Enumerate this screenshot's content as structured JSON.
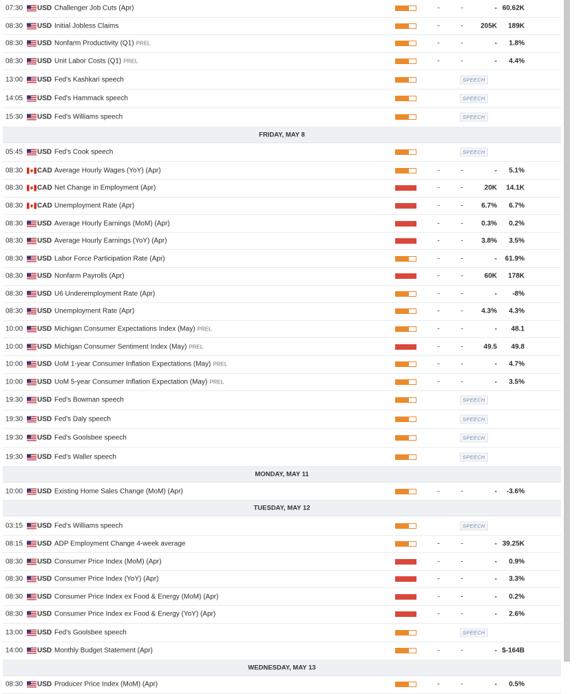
{
  "speech_label": "SPEECH",
  "prel_label": "PREL",
  "rows": [
    {
      "type": "event",
      "time": "07:30",
      "flag": "us",
      "currency": "USD",
      "name": "Challenger Job Cuts (Apr)",
      "prel": false,
      "impact": "medium",
      "actual": "-",
      "forecast": "-",
      "consensus": "-",
      "previous": "60.62K"
    },
    {
      "type": "event",
      "time": "08:30",
      "flag": "us",
      "currency": "USD",
      "name": "Initial Jobless Claims",
      "prel": false,
      "impact": "medium",
      "actual": "-",
      "forecast": "-",
      "consensus": "205K",
      "previous": "189K"
    },
    {
      "type": "event",
      "time": "08:30",
      "flag": "us",
      "currency": "USD",
      "name": "Nonfarm Productivity (Q1)",
      "prel": true,
      "impact": "medium",
      "actual": "-",
      "forecast": "-",
      "consensus": "-",
      "previous": "1.8%"
    },
    {
      "type": "event",
      "time": "08:30",
      "flag": "us",
      "currency": "USD",
      "name": "Unit Labor Costs (Q1)",
      "prel": true,
      "impact": "medium",
      "actual": "-",
      "forecast": "-",
      "consensus": "-",
      "previous": "4.4%"
    },
    {
      "type": "speech",
      "time": "13:00",
      "flag": "us",
      "currency": "USD",
      "name": "Fed's Kashkari speech",
      "impact": "medium"
    },
    {
      "type": "speech",
      "time": "14:05",
      "flag": "us",
      "currency": "USD",
      "name": "Fed's Hammack speech",
      "impact": "medium"
    },
    {
      "type": "speech",
      "time": "15:30",
      "flag": "us",
      "currency": "USD",
      "name": "Fed's Williams speech",
      "impact": "medium"
    },
    {
      "type": "day",
      "label": "FRIDAY, MAY 8"
    },
    {
      "type": "speech",
      "time": "05:45",
      "flag": "us",
      "currency": "USD",
      "name": "Fed's Cook speech",
      "impact": "medium"
    },
    {
      "type": "event",
      "time": "08:30",
      "flag": "ca",
      "currency": "CAD",
      "name": "Average Hourly Wages (YoY) (Apr)",
      "prel": false,
      "impact": "medium",
      "actual": "-",
      "forecast": "-",
      "consensus": "-",
      "previous": "5.1%"
    },
    {
      "type": "event",
      "time": "08:30",
      "flag": "ca",
      "currency": "CAD",
      "name": "Net Change in Employment (Apr)",
      "prel": false,
      "impact": "high",
      "actual": "-",
      "forecast": "-",
      "consensus": "20K",
      "previous": "14.1K"
    },
    {
      "type": "event",
      "time": "08:30",
      "flag": "ca",
      "currency": "CAD",
      "name": "Unemployment Rate (Apr)",
      "prel": false,
      "impact": "high",
      "actual": "-",
      "forecast": "-",
      "consensus": "6.7%",
      "previous": "6.7%"
    },
    {
      "type": "event",
      "time": "08:30",
      "flag": "us",
      "currency": "USD",
      "name": "Average Hourly Earnings (MoM) (Apr)",
      "prel": false,
      "impact": "high",
      "actual": "-",
      "forecast": "-",
      "consensus": "0.3%",
      "previous": "0.2%"
    },
    {
      "type": "event",
      "time": "08:30",
      "flag": "us",
      "currency": "USD",
      "name": "Average Hourly Earnings (YoY) (Apr)",
      "prel": false,
      "impact": "high",
      "actual": "-",
      "forecast": "-",
      "consensus": "3.8%",
      "previous": "3.5%"
    },
    {
      "type": "event",
      "time": "08:30",
      "flag": "us",
      "currency": "USD",
      "name": "Labor Force Participation Rate (Apr)",
      "prel": false,
      "impact": "medium",
      "actual": "-",
      "forecast": "-",
      "consensus": "-",
      "previous": "61.9%"
    },
    {
      "type": "event",
      "time": "08:30",
      "flag": "us",
      "currency": "USD",
      "name": "Nonfarm Payrolls (Apr)",
      "prel": false,
      "impact": "high",
      "actual": "-",
      "forecast": "-",
      "consensus": "60K",
      "previous": "178K"
    },
    {
      "type": "event",
      "time": "08:30",
      "flag": "us",
      "currency": "USD",
      "name": "U6 Underemployment Rate (Apr)",
      "prel": false,
      "impact": "medium",
      "actual": "-",
      "forecast": "-",
      "consensus": "-",
      "previous": "-8%"
    },
    {
      "type": "event",
      "time": "08:30",
      "flag": "us",
      "currency": "USD",
      "name": "Unemployment Rate (Apr)",
      "prel": false,
      "impact": "medium",
      "actual": "-",
      "forecast": "-",
      "consensus": "4.3%",
      "previous": "4.3%"
    },
    {
      "type": "event",
      "time": "10:00",
      "flag": "us",
      "currency": "USD",
      "name": "Michigan Consumer Expectations Index (May)",
      "prel": true,
      "impact": "medium",
      "actual": "-",
      "forecast": "-",
      "consensus": "-",
      "previous": "48.1"
    },
    {
      "type": "event",
      "time": "10:00",
      "flag": "us",
      "currency": "USD",
      "name": "Michigan Consumer Sentiment Index (May)",
      "prel": true,
      "impact": "high",
      "actual": "-",
      "forecast": "-",
      "consensus": "49.5",
      "previous": "49.8"
    },
    {
      "type": "event",
      "time": "10:00",
      "flag": "us",
      "currency": "USD",
      "name": "UoM 1-year Consumer Inflation Expectations (May)",
      "prel": true,
      "impact": "medium",
      "actual": "-",
      "forecast": "-",
      "consensus": "-",
      "previous": "4.7%"
    },
    {
      "type": "event",
      "time": "10:00",
      "flag": "us",
      "currency": "USD",
      "name": "UoM 5-year Consumer Inflation Expectation (May)",
      "prel": true,
      "impact": "medium",
      "actual": "-",
      "forecast": "-",
      "consensus": "-",
      "previous": "3.5%"
    },
    {
      "type": "speech",
      "time": "19:30",
      "flag": "us",
      "currency": "USD",
      "name": "Fed's Bowman speech",
      "impact": "medium"
    },
    {
      "type": "speech",
      "time": "19:30",
      "flag": "us",
      "currency": "USD",
      "name": "Fed's Daly speech",
      "impact": "medium"
    },
    {
      "type": "speech",
      "time": "19:30",
      "flag": "us",
      "currency": "USD",
      "name": "Fed's Goolsbee speech",
      "impact": "medium"
    },
    {
      "type": "speech",
      "time": "19:30",
      "flag": "us",
      "currency": "USD",
      "name": "Fed's Waller speech",
      "impact": "medium"
    },
    {
      "type": "day",
      "label": "MONDAY, MAY 11"
    },
    {
      "type": "event",
      "time": "10:00",
      "flag": "us",
      "currency": "USD",
      "name": "Existing Home Sales Change (MoM) (Apr)",
      "prel": false,
      "impact": "medium",
      "actual": "-",
      "forecast": "-",
      "consensus": "-",
      "previous": "-3.6%"
    },
    {
      "type": "day",
      "label": "TUESDAY, MAY 12"
    },
    {
      "type": "speech",
      "time": "03:15",
      "flag": "us",
      "currency": "USD",
      "name": "Fed's Williams speech",
      "impact": "medium"
    },
    {
      "type": "event",
      "time": "08:15",
      "flag": "us",
      "currency": "USD",
      "name": "ADP Employment Change 4-week average",
      "prel": false,
      "impact": "medium",
      "actual": "-",
      "forecast": "-",
      "consensus": "-",
      "previous": "39.25K"
    },
    {
      "type": "event",
      "time": "08:30",
      "flag": "us",
      "currency": "USD",
      "name": "Consumer Price Index (MoM) (Apr)",
      "prel": false,
      "impact": "high",
      "actual": "-",
      "forecast": "-",
      "consensus": "-",
      "previous": "0.9%"
    },
    {
      "type": "event",
      "time": "08:30",
      "flag": "us",
      "currency": "USD",
      "name": "Consumer Price Index (YoY) (Apr)",
      "prel": false,
      "impact": "high",
      "actual": "-",
      "forecast": "-",
      "consensus": "-",
      "previous": "3.3%"
    },
    {
      "type": "event",
      "time": "08:30",
      "flag": "us",
      "currency": "USD",
      "name": "Consumer Price Index ex Food & Energy (MoM) (Apr)",
      "prel": false,
      "impact": "high",
      "actual": "-",
      "forecast": "-",
      "consensus": "-",
      "previous": "0.2%"
    },
    {
      "type": "event",
      "time": "08:30",
      "flag": "us",
      "currency": "USD",
      "name": "Consumer Price Index ex Food & Energy (YoY) (Apr)",
      "prel": false,
      "impact": "high",
      "actual": "-",
      "forecast": "-",
      "consensus": "-",
      "previous": "2.6%"
    },
    {
      "type": "speech",
      "time": "13:00",
      "flag": "us",
      "currency": "USD",
      "name": "Fed's Goolsbee speech",
      "impact": "medium"
    },
    {
      "type": "event",
      "time": "14:00",
      "flag": "us",
      "currency": "USD",
      "name": "Monthly Budget Statement (Apr)",
      "prel": false,
      "impact": "medium",
      "actual": "-",
      "forecast": "-",
      "consensus": "-",
      "previous": "$-164B"
    },
    {
      "type": "day",
      "label": "WEDNESDAY, MAY 13"
    },
    {
      "type": "event",
      "time": "08:30",
      "flag": "us",
      "currency": "USD",
      "name": "Producer Price Index (MoM) (Apr)",
      "prel": false,
      "impact": "medium",
      "actual": "-",
      "forecast": "-",
      "consensus": "-",
      "previous": "0.5%"
    }
  ]
}
